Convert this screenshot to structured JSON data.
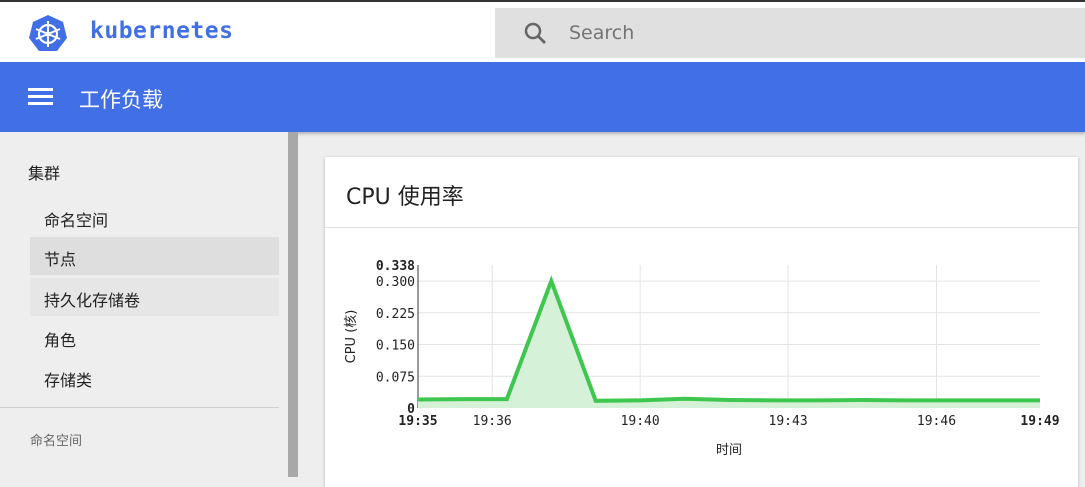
{
  "header": {
    "brand": "kubernetes",
    "search_placeholder": "Search"
  },
  "appbar": {
    "title": "工作负载"
  },
  "sidebar": {
    "section": "集群",
    "items": [
      {
        "label": "命名空间"
      },
      {
        "label": "节点"
      },
      {
        "label": "持久化存储卷"
      },
      {
        "label": "角色"
      },
      {
        "label": "存储类"
      }
    ],
    "namespace_label": "命名空间"
  },
  "card": {
    "title": "CPU 使用率"
  },
  "colors": {
    "accent": "#4170e6",
    "series": "#3fc64e",
    "fill": "#d5f2d8"
  },
  "chart_data": {
    "type": "area",
    "title": "CPU 使用率",
    "xlabel": "时间",
    "ylabel": "CPU (核)",
    "x_unit": "minutes after 19:35",
    "x": [
      0,
      1,
      2,
      3,
      4,
      5,
      6,
      7,
      8,
      9,
      10,
      11,
      12,
      13,
      14
    ],
    "values": [
      0.02,
      0.021,
      0.021,
      0.3,
      0.017,
      0.018,
      0.022,
      0.019,
      0.018,
      0.018,
      0.019,
      0.018,
      0.018,
      0.018,
      0.018
    ],
    "xlim": [
      0,
      14
    ],
    "ylim": [
      0,
      0.338
    ],
    "yticks": [
      {
        "v": 0,
        "label": "0",
        "bold": true
      },
      {
        "v": 0.075,
        "label": "0.075"
      },
      {
        "v": 0.15,
        "label": "0.150"
      },
      {
        "v": 0.225,
        "label": "0.225"
      },
      {
        "v": 0.3,
        "label": "0.300"
      },
      {
        "v": 0.338,
        "label": "0.338",
        "bold": true
      }
    ],
    "xticks": [
      {
        "v": 0,
        "label": "19:35",
        "bold": true
      },
      {
        "v": 1.67,
        "label": "19:36"
      },
      {
        "v": 5,
        "label": "19:40"
      },
      {
        "v": 8.33,
        "label": "19:43"
      },
      {
        "v": 11.67,
        "label": "19:46"
      },
      {
        "v": 14,
        "label": "19:49",
        "bold": true
      }
    ],
    "grid": true
  }
}
